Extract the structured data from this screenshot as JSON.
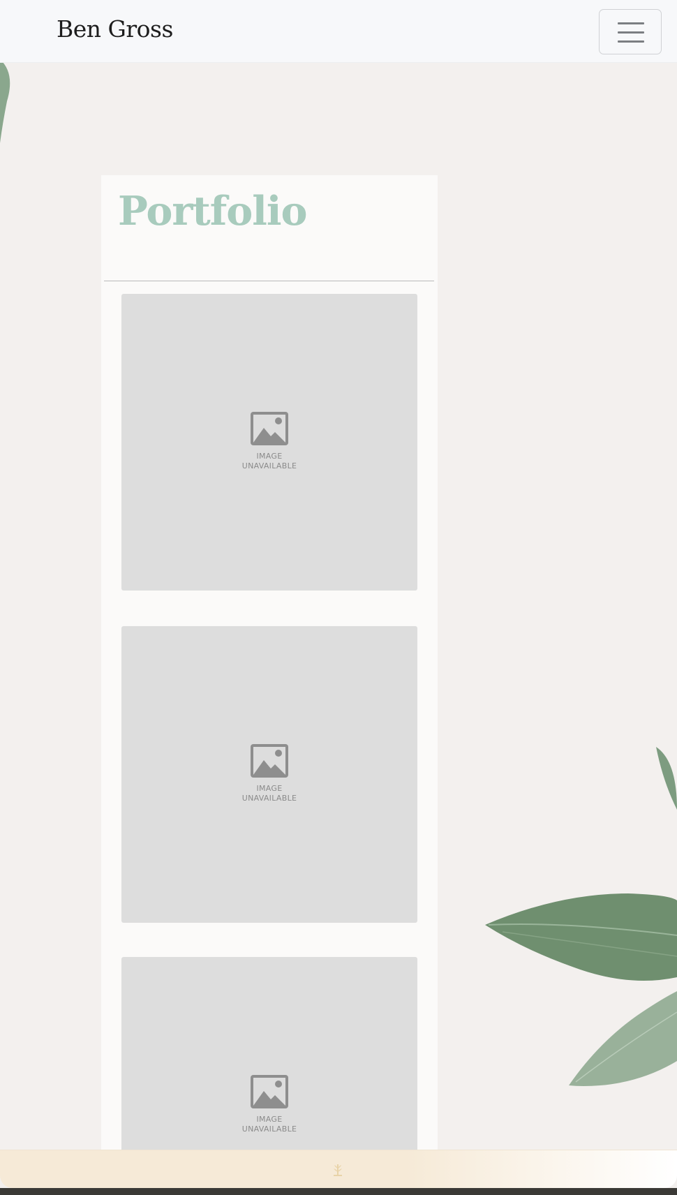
{
  "navbar": {
    "brand": "Ben Gross",
    "menu_icon": "hamburger-menu-icon"
  },
  "main": {
    "title": "Portfolio",
    "images": [
      {
        "line1": "IMAGE",
        "line2": "UNAVAILABLE",
        "icon": "image-placeholder-icon"
      },
      {
        "line1": "IMAGE",
        "line2": "UNAVAILABLE",
        "icon": "image-placeholder-icon"
      },
      {
        "line1": "IMAGE",
        "line2": "UNAVAILABLE",
        "icon": "image-placeholder-icon"
      }
    ]
  },
  "footer": {
    "icon": "wheat-icon"
  },
  "colors": {
    "background": "#f3f0ee",
    "title": "#a8cbbd",
    "navbar": "#f7f8fa",
    "placeholder": "#dddddd",
    "footer": "#f6ead7"
  }
}
